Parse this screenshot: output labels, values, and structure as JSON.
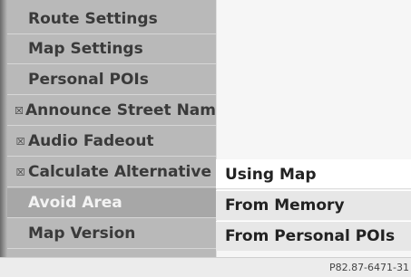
{
  "menu": {
    "items": [
      {
        "label": "Route Settings",
        "checkbox": ""
      },
      {
        "label": "Map Settings",
        "checkbox": ""
      },
      {
        "label": "Personal POIs",
        "checkbox": ""
      },
      {
        "label": "Announce Street Nam",
        "checkbox": "☒"
      },
      {
        "label": "Audio Fadeout",
        "checkbox": "☒"
      },
      {
        "label": "Calculate Alternative",
        "checkbox": "☒"
      },
      {
        "label": "Avoid Area",
        "checkbox": ""
      },
      {
        "label": "Map Version",
        "checkbox": ""
      }
    ]
  },
  "submenu": {
    "items": [
      {
        "label": "Using Map"
      },
      {
        "label": "From Memory"
      },
      {
        "label": "From Personal POIs"
      }
    ]
  },
  "footer": {
    "ref_code": "P82.87-6471-31"
  }
}
